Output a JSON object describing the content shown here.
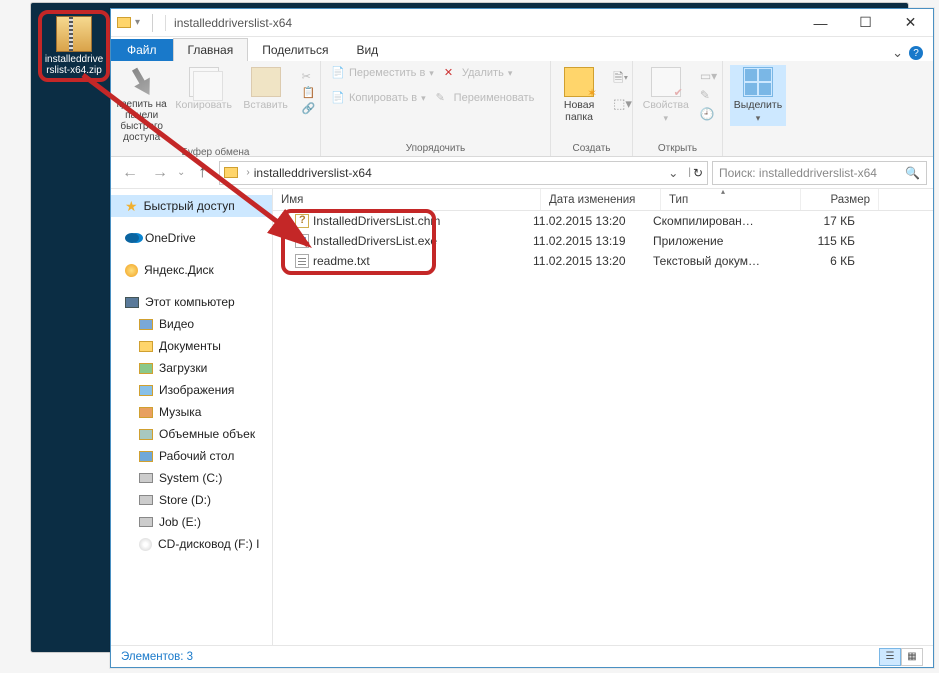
{
  "desktop_icon": {
    "label": "installeddrive\nrslist-x64.zip"
  },
  "window": {
    "title": "installeddriverslist-x64",
    "tabs": {
      "file": "Файл",
      "home": "Главная",
      "share": "Поделиться",
      "view": "Вид"
    },
    "win_controls": {
      "min": "—",
      "max": "☐",
      "close": "✕"
    }
  },
  "ribbon": {
    "clipboard": {
      "pin": "крепить на панели быстрого доступа",
      "copy": "Копировать",
      "paste": "Вставить",
      "group": "Буфер обмена"
    },
    "organize": {
      "moveto": "Переместить в",
      "copyto": "Копировать в",
      "delete": "Удалить",
      "rename": "Переименовать",
      "group": "Упорядочить"
    },
    "new": {
      "newfolder": "Новая\nпапка",
      "group": "Создать"
    },
    "open": {
      "properties": "Свойства",
      "group": "Открыть"
    },
    "select": {
      "select": "Выделить",
      "group": ""
    }
  },
  "address": {
    "path": "installeddriverslist-x64",
    "search_placeholder": "Поиск: installeddriverslist-x64"
  },
  "nav": {
    "quick": "Быстрый доступ",
    "onedrive": "OneDrive",
    "yandex": "Яндекс.Диск",
    "thispc": "Этот компьютер",
    "videos": "Видео",
    "documents": "Документы",
    "downloads": "Загрузки",
    "pictures": "Изображения",
    "music": "Музыка",
    "objects3d": "Объемные объек",
    "desktop": "Рабочий стол",
    "system_c": "System (C:)",
    "store_d": "Store (D:)",
    "job_e": "Job (E:)",
    "cd_f": "CD-дисковод (F:) I"
  },
  "columns": {
    "name": "Имя",
    "date": "Дата изменения",
    "type": "Тип",
    "size": "Размер"
  },
  "files": [
    {
      "name": "InstalledDriversList.chm",
      "date": "11.02.2015 13:20",
      "type": "Скомпилирован…",
      "size": "17 КБ",
      "ico": "chm"
    },
    {
      "name": "InstalledDriversList.exe",
      "date": "11.02.2015 13:19",
      "type": "Приложение",
      "size": "115 КБ",
      "ico": "exe"
    },
    {
      "name": "readme.txt",
      "date": "11.02.2015 13:20",
      "type": "Текстовый докум…",
      "size": "6 КБ",
      "ico": "txt"
    }
  ],
  "status": {
    "items": "Элементов: 3"
  },
  "colors": {
    "accent": "#1979ca",
    "highlight": "#c42727"
  }
}
